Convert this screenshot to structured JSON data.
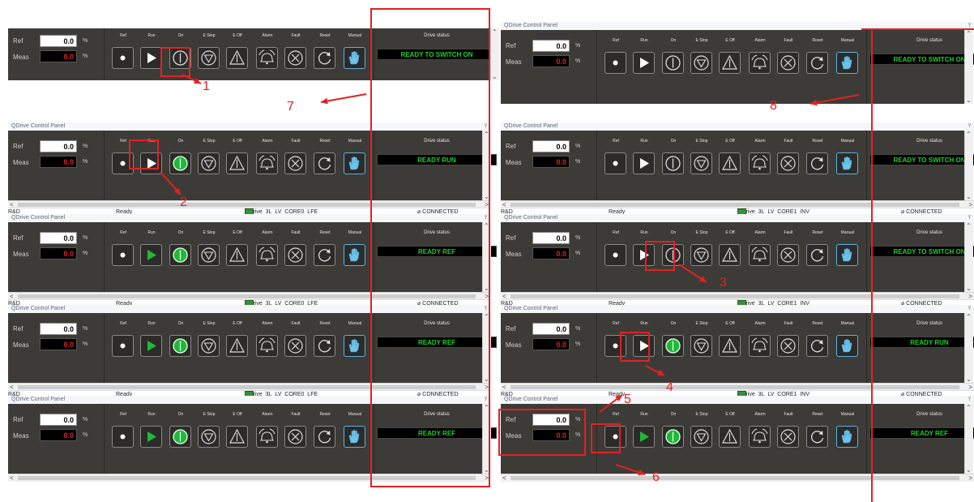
{
  "panel_title": "QDrive Control Panel",
  "clipped_title": "QDrive Control Panel",
  "labels": {
    "ref": "Ref",
    "meas": "Meas",
    "percent": "%",
    "drive_status": "Drive status"
  },
  "buttons": [
    "Ref",
    "Run",
    "On",
    "E Stop",
    "E Off",
    "Alarm",
    "Fault",
    "Reset",
    "Manual"
  ],
  "panels": [
    {
      "id": "p0",
      "ref_value": "0.0",
      "meas_value": "0.0",
      "drive_status": "READY TO SWITCH ON",
      "status_text": "",
      "drive_name": "",
      "connection": "",
      "run_active": false,
      "on_active": false,
      "has_title": false
    },
    {
      "id": "p1",
      "ref_value": "0.0",
      "meas_value": "0.0",
      "drive_status": "READY TO SWITCH ON",
      "status_text": "",
      "drive_name": "",
      "connection": "",
      "run_active": false,
      "on_active": false,
      "has_title": true
    },
    {
      "id": "p2",
      "ref_value": "0.0",
      "meas_value": "0.0",
      "drive_status": "READY RUN",
      "status_text": "Ready",
      "drive_name": "QDrive_3L_LV_CORE0_LFE",
      "connection": "CONNECTED",
      "run_active": false,
      "on_active": true,
      "has_title": true
    },
    {
      "id": "p3",
      "ref_value": "0.0",
      "meas_value": "0.0",
      "drive_status": "READY TO SWITCH ON",
      "status_text": "Ready",
      "drive_name": "QDrive_3L_LV_CORE1_INV",
      "connection": "CONNECTED",
      "run_active": false,
      "on_active": false,
      "has_title": true
    },
    {
      "id": "p4",
      "ref_value": "0.0",
      "meas_value": "0.0",
      "drive_status": "READY REF",
      "status_text": "Ready",
      "drive_name": "QDrive_3L_LV_CORE0_LFE",
      "connection": "CONNECTED",
      "run_active": true,
      "on_active": true,
      "has_title": true
    },
    {
      "id": "p5",
      "ref_value": "0.0",
      "meas_value": "0.0",
      "drive_status": "READY TO SWITCH ON",
      "status_text": "Ready",
      "drive_name": "QDrive_3L_LV_CORE1_INV",
      "connection": "CONNECTED",
      "run_active": false,
      "on_active": false,
      "has_title": true
    },
    {
      "id": "p6",
      "ref_value": "0.0",
      "meas_value": "0.0",
      "drive_status": "READY REF",
      "status_text": "Ready",
      "drive_name": "QDrive_3L_LV_CORE0_LFE",
      "connection": "CONNECTED",
      "run_active": true,
      "on_active": true,
      "has_title": true
    },
    {
      "id": "p7",
      "ref_value": "0.0",
      "meas_value": "0.0",
      "drive_status": "READY RUN",
      "status_text": "Ready",
      "drive_name": "QDrive_3L_LV_CORE1_INV",
      "connection": "CONNECTED",
      "run_active": false,
      "on_active": true,
      "has_title": true
    },
    {
      "id": "p8",
      "ref_value": "0.0",
      "meas_value": "0.0",
      "drive_status": "READY REF",
      "status_text": "",
      "drive_name": "",
      "connection": "",
      "run_active": true,
      "on_active": true,
      "has_title": true
    },
    {
      "id": "p9",
      "ref_value": "0.0",
      "meas_value": "0.0",
      "drive_status": "READY REF",
      "status_text": "",
      "drive_name": "",
      "connection": "",
      "run_active": true,
      "on_active": true,
      "has_title": true
    }
  ],
  "status_footer": {
    "left_label": "R&D"
  },
  "annotations": [
    "1",
    "2",
    "3",
    "4",
    "5",
    "6",
    "7",
    "8"
  ],
  "colors": {
    "highlight": "#e52020",
    "status_green": "#1ed02a",
    "active_green": "#1fb83a",
    "meas_red": "#e02020",
    "panel_bg": "#3d3b37"
  }
}
